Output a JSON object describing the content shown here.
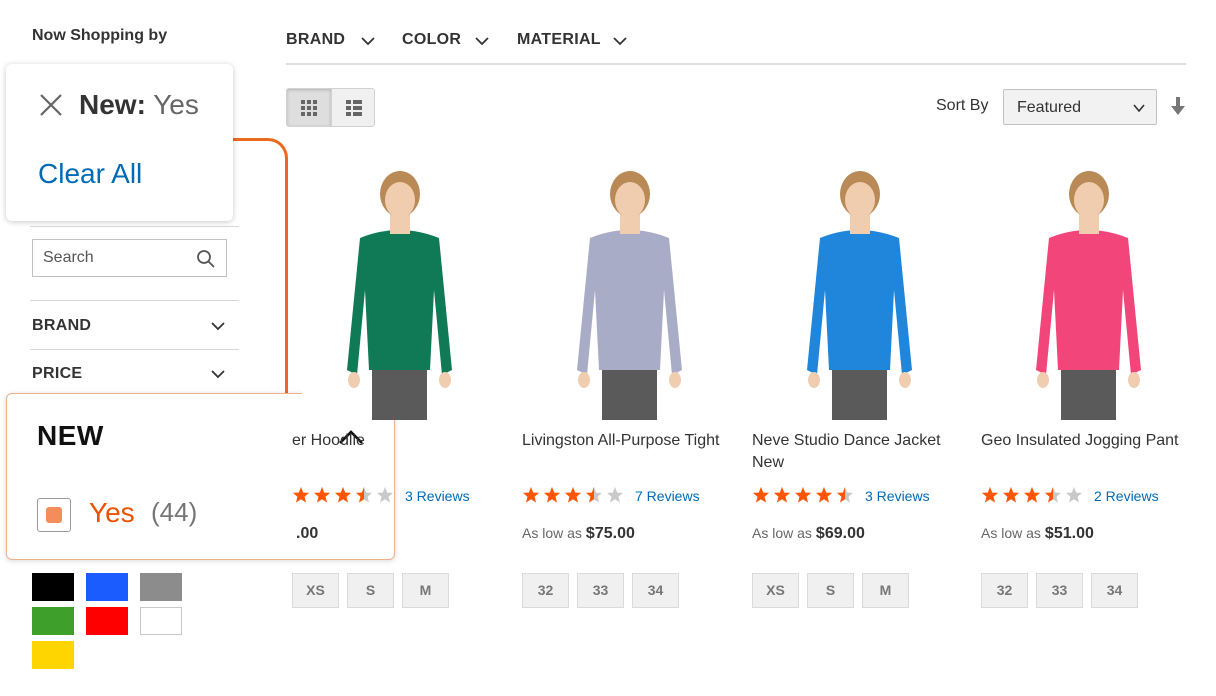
{
  "sidebar": {
    "now_shopping_title": "Now Shopping by",
    "active_filter": {
      "name": "New:",
      "value": "Yes"
    },
    "clear_all": "Clear All",
    "search_placeholder": "Search",
    "filters": [
      {
        "label": "BRAND"
      },
      {
        "label": "PRICE"
      }
    ],
    "new_filter": {
      "title": "NEW",
      "options": [
        {
          "label": "Yes",
          "count": "(44)",
          "checked": true
        }
      ]
    },
    "color_swatches": [
      "#000000",
      "#1a5cff",
      "#8c8c8c",
      "#3ea02a",
      "#ff0000",
      "#ffffff",
      "#ffd500"
    ]
  },
  "top_filters": [
    {
      "label": "BRAND"
    },
    {
      "label": "COLOR"
    },
    {
      "label": "MATERIAL"
    }
  ],
  "toolbar": {
    "view_modes": [
      "grid-icon",
      "list-icon"
    ],
    "sort_label": "Sort By",
    "sort_value": "Featured"
  },
  "products": [
    {
      "name": "er Hoodlie",
      "rating": 3.5,
      "reviews": "3  Reviews",
      "price_prefix": "",
      "price": ".00",
      "sizes": [
        "XS",
        "S",
        "M"
      ],
      "garment_color": "#0f7a55"
    },
    {
      "name": "Livingston All-Purpose Tight",
      "rating": 3.5,
      "reviews": "7  Reviews",
      "price_prefix": "As low as",
      "price": "$75.00",
      "sizes": [
        "32",
        "33",
        "34"
      ],
      "garment_color": "#a9acc6"
    },
    {
      "name": "Neve Studio Dance Jacket New",
      "rating": 4.5,
      "reviews": "3  Reviews",
      "price_prefix": "As low as",
      "price": "$69.00",
      "sizes": [
        "XS",
        "S",
        "M"
      ],
      "garment_color": "#1f86dc"
    },
    {
      "name": "Geo Insulated Jogging Pant",
      "rating": 3.5,
      "reviews": "2  Reviews",
      "price_prefix": "As low as",
      "price": "$51.00",
      "sizes": [
        "32",
        "33",
        "34"
      ],
      "garment_color": "#f2467a"
    }
  ],
  "colors": {
    "accent_orange": "#eb6a1f",
    "link_blue": "#006bb4",
    "star_orange": "#ff5501",
    "star_empty": "#c9c9c9"
  }
}
